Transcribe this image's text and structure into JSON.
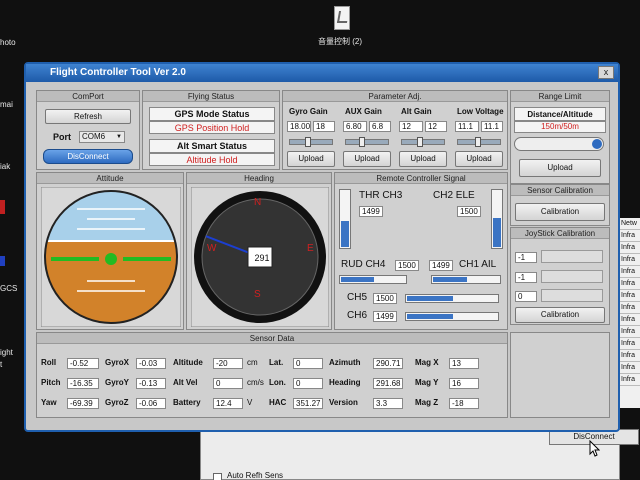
{
  "desktop": {
    "icon_label": "音量控制 (2)",
    "left_fragments": [
      "hoto",
      "mai",
      "iak",
      "GCS",
      "ight",
      "t"
    ]
  },
  "window": {
    "title": "Flight Controller Tool  Ver 2.0",
    "close_glyph": "x"
  },
  "comport": {
    "header": "ComPort",
    "refresh_label": "Refresh",
    "port_label": "Port",
    "port_value": "COM6",
    "disconnect_label": "DisConnect"
  },
  "flying_status": {
    "header": "Flying Status",
    "gps_title": "GPS Mode Status",
    "gps_value": "GPS Position Hold",
    "alt_title": "Alt Smart Status",
    "alt_value": "Altitude Hold"
  },
  "param_adj": {
    "header": "Parameter Adj.",
    "groups": [
      {
        "label": "Gyro Gain",
        "val1": "18.00",
        "val2": "18",
        "slider": 0.4,
        "upload": "Upload"
      },
      {
        "label": "AUX Gain",
        "val1": "6.80",
        "val2": "6.8",
        "slider": 0.35,
        "upload": "Upload"
      },
      {
        "label": "Alt Gain",
        "val1": "12",
        "val2": "12",
        "slider": 0.4,
        "upload": "Upload"
      },
      {
        "label": "Low Voltage",
        "val1": "11.1",
        "val2": "11.1",
        "slider": 0.45,
        "upload": "Upload"
      }
    ]
  },
  "range_limit": {
    "header": "Range Limit",
    "title": "Distance/Altitude",
    "value": "150m/50m",
    "upload": "Upload"
  },
  "sensor_cal": {
    "header": "Sensor Calibration",
    "button": "Calibration"
  },
  "joystick_cal": {
    "header": "JoyStick Calibration",
    "values": [
      "-1",
      "-1",
      "0"
    ],
    "button": "Calibration"
  },
  "attitude": {
    "header": "Attitude"
  },
  "heading": {
    "header": "Heading",
    "value": "291",
    "n": "N",
    "s": "S",
    "e": "E",
    "w": "W"
  },
  "rc": {
    "header": "Remote Controller Signal",
    "thr_label": "THR CH3",
    "thr_value": "1499",
    "ele_label": "CH2 ELE",
    "ele_value": "1500",
    "rud_label": "RUD CH4",
    "rud_value": "1500",
    "ail_value": "1499",
    "ail_label": "CH1 AIL",
    "ch5_label": "CH5",
    "ch5_value": "1500",
    "ch6_label": "CH6",
    "ch6_value": "1499",
    "thr_level": 0.45,
    "ele_level": 0.5,
    "rud_level": 0.5,
    "ail_level": 0.5,
    "ch5_level": 0.5,
    "ch6_level": 0.5
  },
  "sensor_data": {
    "header": "Sensor Data",
    "roll": {
      "label": "Roll",
      "value": "-0.52"
    },
    "pitch": {
      "label": "Pitch",
      "value": "-16.35"
    },
    "yaw": {
      "label": "Yaw",
      "value": "-69.39"
    },
    "gyrox": {
      "label": "GyroX",
      "value": "-0.03"
    },
    "gyroy": {
      "label": "GyroY",
      "value": "-0.13"
    },
    "gyroz": {
      "label": "GyroZ",
      "value": "-0.06"
    },
    "altitude": {
      "label": "Altitude",
      "value": "-20",
      "unit": "cm"
    },
    "altvel": {
      "label": "Alt Vel",
      "value": "0",
      "unit": "cm/s"
    },
    "battery": {
      "label": "Battery",
      "value": "12.4",
      "unit": "V"
    },
    "lat": {
      "label": "Lat.",
      "value": "0"
    },
    "lon": {
      "label": "Lon.",
      "value": "0"
    },
    "hac": {
      "label": "HAC",
      "value": "351.27"
    },
    "azimuth": {
      "label": "Azimuth",
      "value": "290.71"
    },
    "heading": {
      "label": "Heading",
      "value": "291.68"
    },
    "version": {
      "label": "Version",
      "value": "3.3"
    },
    "magx": {
      "label": "Mag X",
      "value": "13"
    },
    "magy": {
      "label": "Mag Y",
      "value": "16"
    },
    "magz": {
      "label": "Mag Z",
      "value": "-18"
    }
  },
  "background_window": {
    "button": "DisConnect",
    "checkbox_label": "Auto Refh Sens"
  },
  "right_list": [
    "Netw",
    "Infra",
    "Infra",
    "Infra",
    "Infra",
    "Infra",
    "Infra",
    "Infra",
    "Infra",
    "Infra",
    "Infra",
    "Infra",
    "Infra",
    "Infra"
  ],
  "colors": {
    "sky": "#a8d0ea",
    "ground": "#d2822a",
    "horizon_marker": "#22bb22",
    "heading_needle": "#1c3fd0",
    "compass_letters": "#e02020",
    "title_bar": "#2e6bc0"
  }
}
